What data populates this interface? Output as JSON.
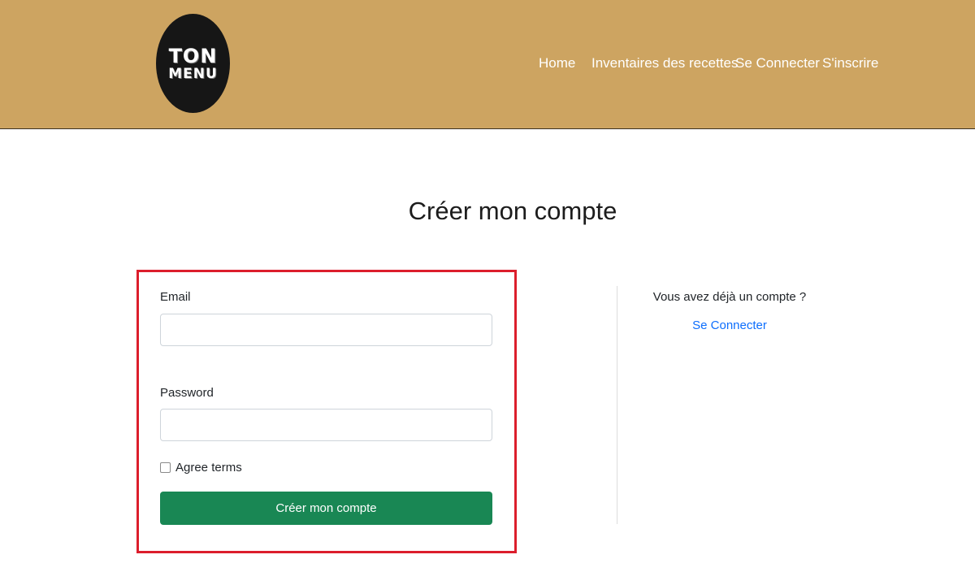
{
  "header": {
    "logo": {
      "line1": "TON",
      "line2": "MENU"
    },
    "nav": [
      {
        "label": "Home"
      },
      {
        "label": "Inventaires des recettes"
      },
      {
        "label": "Se Connecter"
      },
      {
        "label": "S'inscrire"
      }
    ]
  },
  "main": {
    "title": "Créer mon compte",
    "form": {
      "email_label": "Email",
      "email_value": "",
      "password_label": "Password",
      "password_value": "",
      "agree_label": "Agree terms",
      "agree_checked": false,
      "submit_label": "Créer mon compte"
    },
    "aside": {
      "question": "Vous avez déjà un compte ?",
      "login_link": "Se Connecter"
    }
  },
  "colors": {
    "header_bg": "#cda461",
    "submit_bg": "#198754",
    "link": "#0d6efd",
    "highlight_border": "#dc1e2c"
  }
}
